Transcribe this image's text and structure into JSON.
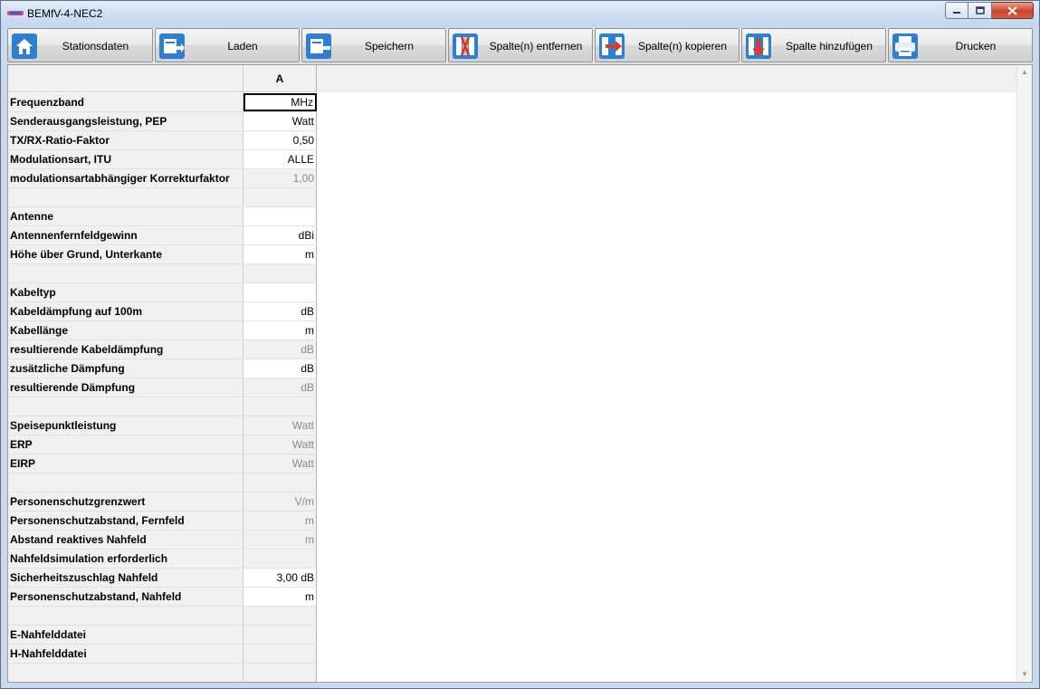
{
  "window": {
    "title": "BEMfV-4-NEC2"
  },
  "toolbar": {
    "buttons": [
      {
        "label": "Stationsdaten",
        "icon": "house-icon"
      },
      {
        "label": "Laden",
        "icon": "load-icon"
      },
      {
        "label": "Speichern",
        "icon": "save-icon"
      },
      {
        "label": "Spalte(n) entfernen",
        "icon": "remove-column-icon"
      },
      {
        "label": "Spalte(n) kopieren",
        "icon": "copy-column-icon"
      },
      {
        "label": "Spalte hinzufügen",
        "icon": "add-column-icon"
      },
      {
        "label": "Drucken",
        "icon": "printer-icon"
      }
    ]
  },
  "grid": {
    "column_header": "A",
    "rows": [
      {
        "label": "Frequenzband",
        "value": "MHz",
        "state": "selected"
      },
      {
        "label": "Senderausgangsleistung, PEP",
        "value": "Watt",
        "state": "editable"
      },
      {
        "label": "TX/RX-Ratio-Faktor",
        "value": "0,50",
        "state": "editable"
      },
      {
        "label": "Modulationsart, ITU",
        "value": "ALLE",
        "state": "editable"
      },
      {
        "label": "modulationsartabhängiger Korrekturfaktor",
        "value": "1,00",
        "state": "readonly"
      },
      {
        "label": "",
        "value": "",
        "state": "readonly"
      },
      {
        "label": "Antenne",
        "value": "",
        "state": "editable"
      },
      {
        "label": "Antennenfernfeldgewinn",
        "value": "dBi",
        "state": "editable"
      },
      {
        "label": "Höhe über Grund, Unterkante",
        "value": "m",
        "state": "editable"
      },
      {
        "label": "",
        "value": "",
        "state": "readonly"
      },
      {
        "label": "Kabeltyp",
        "value": "",
        "state": "editable"
      },
      {
        "label": "Kabeldämpfung auf 100m",
        "value": "dB",
        "state": "editable"
      },
      {
        "label": "Kabellänge",
        "value": "m",
        "state": "editable"
      },
      {
        "label": "resultierende Kabeldämpfung",
        "value": "dB",
        "state": "readonly"
      },
      {
        "label": "zusätzliche Dämpfung",
        "value": "dB",
        "state": "editable"
      },
      {
        "label": "resultierende Dämpfung",
        "value": "dB",
        "state": "readonly"
      },
      {
        "label": "",
        "value": "",
        "state": "readonly"
      },
      {
        "label": "Speisepunktleistung",
        "value": "Watt",
        "state": "readonly"
      },
      {
        "label": "ERP",
        "value": "Watt",
        "state": "readonly"
      },
      {
        "label": "EIRP",
        "value": "Watt",
        "state": "readonly"
      },
      {
        "label": "",
        "value": "",
        "state": "readonly"
      },
      {
        "label": "Personenschutzgrenzwert",
        "value": "V/m",
        "state": "readonly"
      },
      {
        "label": "Personenschutzabstand, Fernfeld",
        "value": "m",
        "state": "readonly"
      },
      {
        "label": "Abstand reaktives Nahfeld",
        "value": "m",
        "state": "readonly"
      },
      {
        "label": "Nahfeldsimulation erforderlich",
        "value": "",
        "state": "readonly"
      },
      {
        "label": "Sicherheitszuschlag Nahfeld",
        "value": "3,00 dB",
        "state": "editable"
      },
      {
        "label": "Personenschutzabstand, Nahfeld",
        "value": "m",
        "state": "editable"
      },
      {
        "label": "",
        "value": "",
        "state": "readonly"
      },
      {
        "label": "E-Nahfelddatei",
        "value": "",
        "state": "readonly"
      },
      {
        "label": "H-Nahfelddatei",
        "value": "",
        "state": "readonly"
      }
    ]
  }
}
